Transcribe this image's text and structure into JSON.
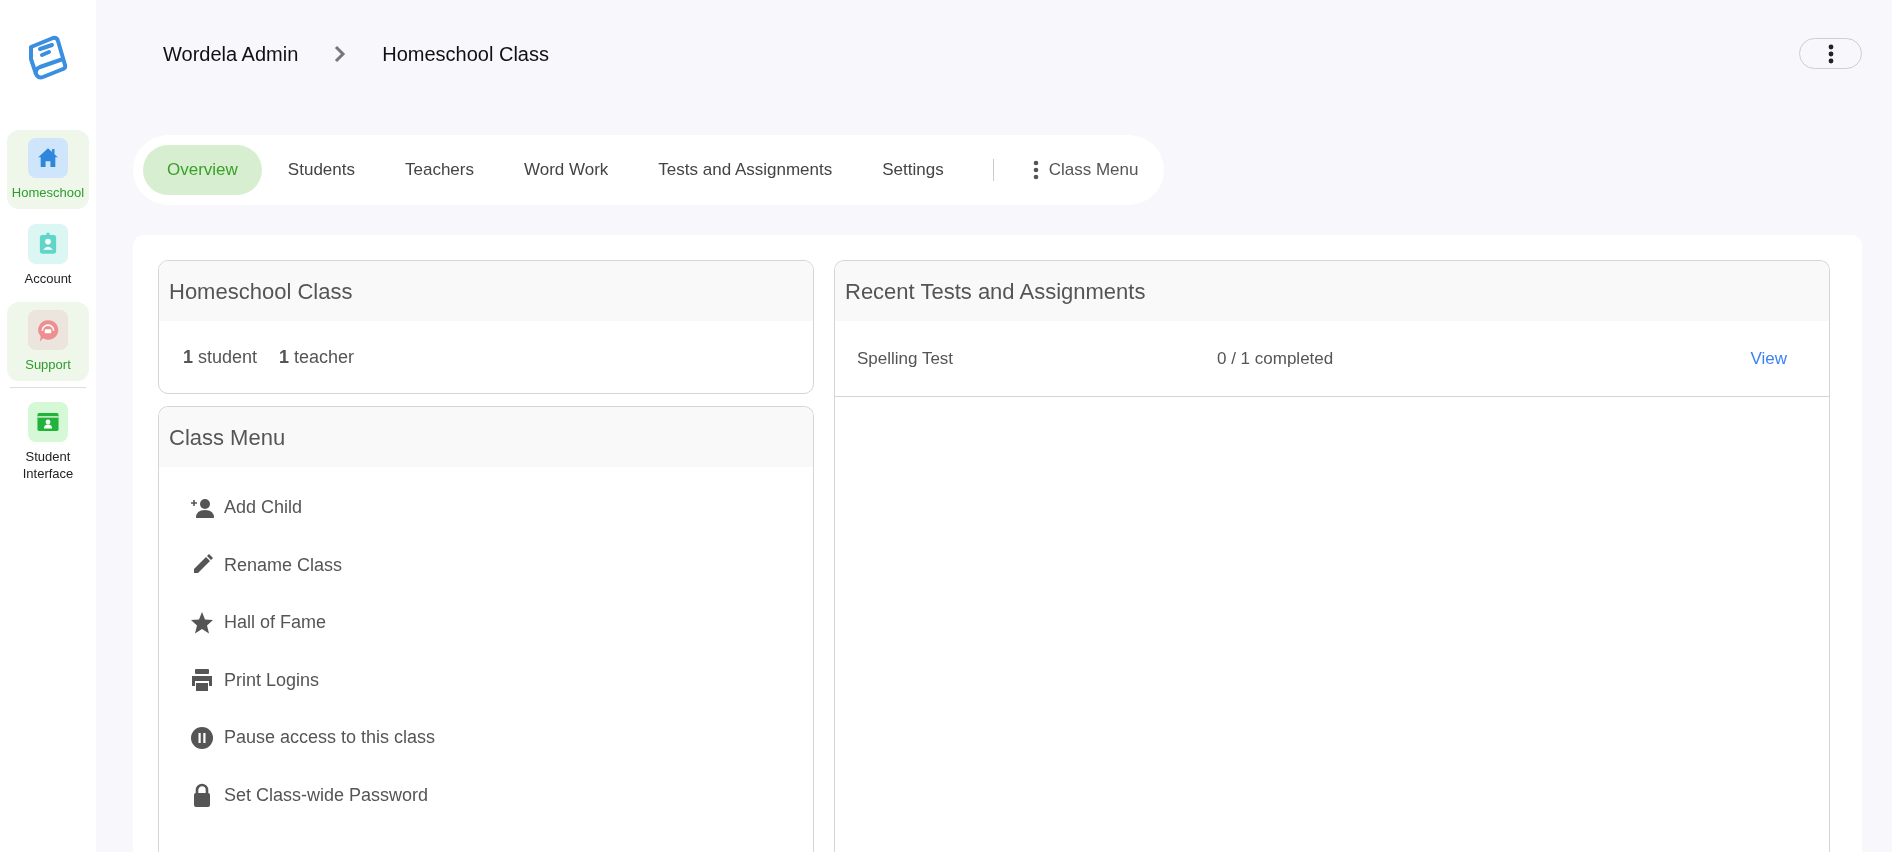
{
  "sidebar": {
    "items": [
      {
        "kind": "home",
        "label": "Homeschool",
        "selected": true
      },
      {
        "kind": "account",
        "label": "Account",
        "selected": false
      },
      {
        "kind": "support",
        "label": "Support",
        "selected": true
      },
      {
        "kind": "student",
        "label": "Student Interface",
        "selected": false
      }
    ]
  },
  "breadcrumb": [
    "Wordela Admin",
    "Homeschool Class"
  ],
  "tabs": [
    {
      "kind": "tab",
      "label": "Overview",
      "selected": true
    },
    {
      "kind": "tab",
      "label": "Students",
      "selected": false
    },
    {
      "kind": "tab",
      "label": "Teachers",
      "selected": false
    },
    {
      "kind": "tab",
      "label": "Word Work",
      "selected": false
    },
    {
      "kind": "tab",
      "label": "Tests and Assignments",
      "selected": false
    },
    {
      "kind": "tab",
      "label": "Settings",
      "selected": false
    },
    {
      "kind": "menu",
      "label": "Class Menu",
      "selected": false
    }
  ],
  "class_card": {
    "title": "Homeschool Class",
    "counts": [
      "**1** student",
      "**1** teacher"
    ]
  },
  "class_menu": {
    "title": "Class Menu",
    "items": [
      {
        "kind": "add-person",
        "label": "Add Child"
      },
      {
        "kind": "pencil",
        "label": "Rename Class"
      },
      {
        "kind": "star",
        "label": "Hall of Fame"
      },
      {
        "kind": "printer",
        "label": "Print Logins"
      },
      {
        "kind": "pause",
        "label": "Pause access to this class"
      },
      {
        "kind": "lock",
        "label": "Set Class-wide Password"
      }
    ]
  },
  "recent": {
    "title": "Recent Tests and Assignments",
    "rows": [
      {
        "name": "Spelling Test",
        "progress": "0 / 1 completed",
        "action": "View"
      }
    ]
  }
}
